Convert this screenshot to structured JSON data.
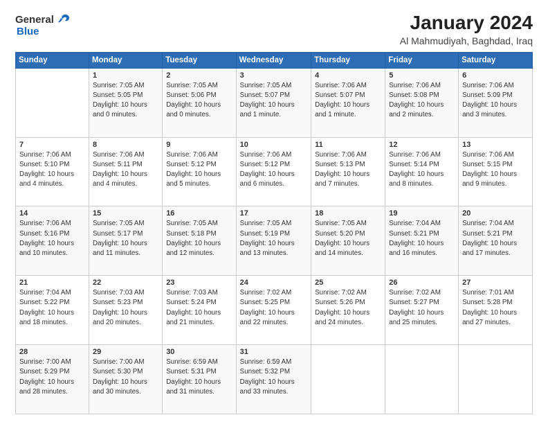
{
  "header": {
    "logo_general": "General",
    "logo_blue": "Blue",
    "title": "January 2024",
    "subtitle": "Al Mahmudiyah, Baghdad, Iraq"
  },
  "calendar": {
    "days_of_week": [
      "Sunday",
      "Monday",
      "Tuesday",
      "Wednesday",
      "Thursday",
      "Friday",
      "Saturday"
    ],
    "weeks": [
      [
        {
          "day": "",
          "info": ""
        },
        {
          "day": "1",
          "info": "Sunrise: 7:05 AM\nSunset: 5:05 PM\nDaylight: 10 hours\nand 0 minutes."
        },
        {
          "day": "2",
          "info": "Sunrise: 7:05 AM\nSunset: 5:06 PM\nDaylight: 10 hours\nand 0 minutes."
        },
        {
          "day": "3",
          "info": "Sunrise: 7:05 AM\nSunset: 5:07 PM\nDaylight: 10 hours\nand 1 minute."
        },
        {
          "day": "4",
          "info": "Sunrise: 7:06 AM\nSunset: 5:07 PM\nDaylight: 10 hours\nand 1 minute."
        },
        {
          "day": "5",
          "info": "Sunrise: 7:06 AM\nSunset: 5:08 PM\nDaylight: 10 hours\nand 2 minutes."
        },
        {
          "day": "6",
          "info": "Sunrise: 7:06 AM\nSunset: 5:09 PM\nDaylight: 10 hours\nand 3 minutes."
        }
      ],
      [
        {
          "day": "7",
          "info": "Sunrise: 7:06 AM\nSunset: 5:10 PM\nDaylight: 10 hours\nand 4 minutes."
        },
        {
          "day": "8",
          "info": "Sunrise: 7:06 AM\nSunset: 5:11 PM\nDaylight: 10 hours\nand 4 minutes."
        },
        {
          "day": "9",
          "info": "Sunrise: 7:06 AM\nSunset: 5:12 PM\nDaylight: 10 hours\nand 5 minutes."
        },
        {
          "day": "10",
          "info": "Sunrise: 7:06 AM\nSunset: 5:12 PM\nDaylight: 10 hours\nand 6 minutes."
        },
        {
          "day": "11",
          "info": "Sunrise: 7:06 AM\nSunset: 5:13 PM\nDaylight: 10 hours\nand 7 minutes."
        },
        {
          "day": "12",
          "info": "Sunrise: 7:06 AM\nSunset: 5:14 PM\nDaylight: 10 hours\nand 8 minutes."
        },
        {
          "day": "13",
          "info": "Sunrise: 7:06 AM\nSunset: 5:15 PM\nDaylight: 10 hours\nand 9 minutes."
        }
      ],
      [
        {
          "day": "14",
          "info": "Sunrise: 7:06 AM\nSunset: 5:16 PM\nDaylight: 10 hours\nand 10 minutes."
        },
        {
          "day": "15",
          "info": "Sunrise: 7:05 AM\nSunset: 5:17 PM\nDaylight: 10 hours\nand 11 minutes."
        },
        {
          "day": "16",
          "info": "Sunrise: 7:05 AM\nSunset: 5:18 PM\nDaylight: 10 hours\nand 12 minutes."
        },
        {
          "day": "17",
          "info": "Sunrise: 7:05 AM\nSunset: 5:19 PM\nDaylight: 10 hours\nand 13 minutes."
        },
        {
          "day": "18",
          "info": "Sunrise: 7:05 AM\nSunset: 5:20 PM\nDaylight: 10 hours\nand 14 minutes."
        },
        {
          "day": "19",
          "info": "Sunrise: 7:04 AM\nSunset: 5:21 PM\nDaylight: 10 hours\nand 16 minutes."
        },
        {
          "day": "20",
          "info": "Sunrise: 7:04 AM\nSunset: 5:21 PM\nDaylight: 10 hours\nand 17 minutes."
        }
      ],
      [
        {
          "day": "21",
          "info": "Sunrise: 7:04 AM\nSunset: 5:22 PM\nDaylight: 10 hours\nand 18 minutes."
        },
        {
          "day": "22",
          "info": "Sunrise: 7:03 AM\nSunset: 5:23 PM\nDaylight: 10 hours\nand 20 minutes."
        },
        {
          "day": "23",
          "info": "Sunrise: 7:03 AM\nSunset: 5:24 PM\nDaylight: 10 hours\nand 21 minutes."
        },
        {
          "day": "24",
          "info": "Sunrise: 7:02 AM\nSunset: 5:25 PM\nDaylight: 10 hours\nand 22 minutes."
        },
        {
          "day": "25",
          "info": "Sunrise: 7:02 AM\nSunset: 5:26 PM\nDaylight: 10 hours\nand 24 minutes."
        },
        {
          "day": "26",
          "info": "Sunrise: 7:02 AM\nSunset: 5:27 PM\nDaylight: 10 hours\nand 25 minutes."
        },
        {
          "day": "27",
          "info": "Sunrise: 7:01 AM\nSunset: 5:28 PM\nDaylight: 10 hours\nand 27 minutes."
        }
      ],
      [
        {
          "day": "28",
          "info": "Sunrise: 7:00 AM\nSunset: 5:29 PM\nDaylight: 10 hours\nand 28 minutes."
        },
        {
          "day": "29",
          "info": "Sunrise: 7:00 AM\nSunset: 5:30 PM\nDaylight: 10 hours\nand 30 minutes."
        },
        {
          "day": "30",
          "info": "Sunrise: 6:59 AM\nSunset: 5:31 PM\nDaylight: 10 hours\nand 31 minutes."
        },
        {
          "day": "31",
          "info": "Sunrise: 6:59 AM\nSunset: 5:32 PM\nDaylight: 10 hours\nand 33 minutes."
        },
        {
          "day": "",
          "info": ""
        },
        {
          "day": "",
          "info": ""
        },
        {
          "day": "",
          "info": ""
        }
      ]
    ]
  }
}
